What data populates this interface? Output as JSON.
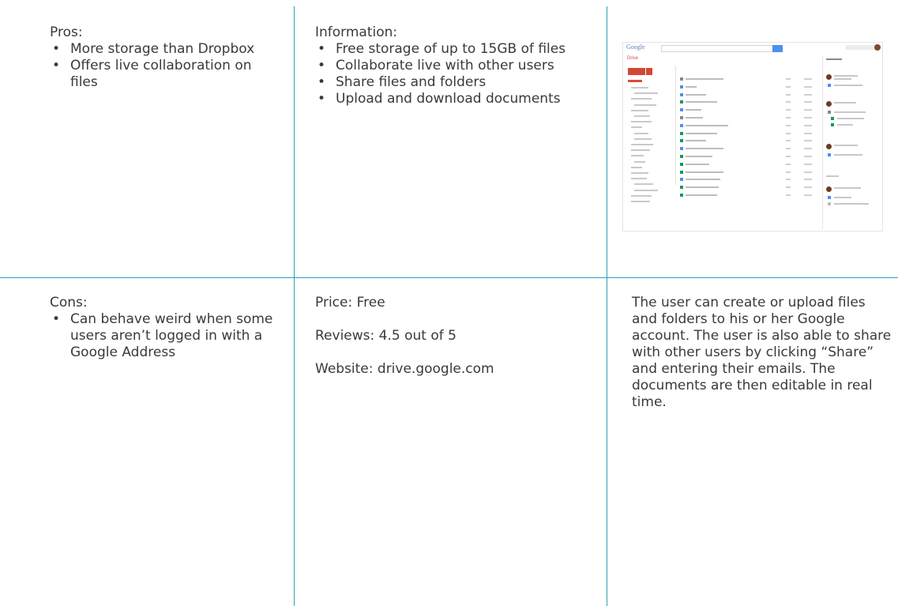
{
  "pros": {
    "heading": "Pros:",
    "bullet": "•",
    "items": [
      "More storage than Dropbox",
      "Offers live collaboration on files"
    ]
  },
  "information": {
    "heading": "Information:",
    "bullet": "•",
    "items": [
      "Free storage of up to 15GB of files",
      "Collaborate live with other users",
      "Share files and folders",
      "Upload and download documents"
    ]
  },
  "cons": {
    "heading": "Cons:",
    "bullet": "•",
    "items": [
      "Can behave weird when some users aren’t logged in with a Google Address"
    ]
  },
  "details": {
    "price": "Price: Free",
    "reviews": "Reviews: 4.5 out of 5",
    "website": "Website: drive.google.com"
  },
  "description": "The user can create or upload files and folders to his or her Google account. The user is also able to share with other users by clicking “Share” and entering their emails. The documents are then editable in real time.",
  "screenshot": {
    "logo": "Google",
    "app_label": "Drive"
  },
  "colors": {
    "grid_lines": "#2aa3b5",
    "text": "#3a3a3a",
    "drive_red": "#dd4b39",
    "google_blue": "#4d8ff0"
  }
}
